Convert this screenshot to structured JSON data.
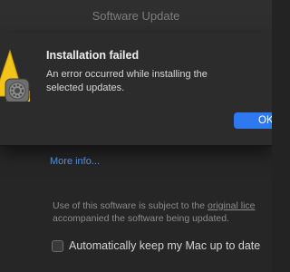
{
  "window": {
    "title": "Software Update"
  },
  "alert": {
    "title": "Installation failed",
    "message": "An error occurred while installing the selected updates.",
    "ok_label": "OK",
    "icon": "warning-gear-icon"
  },
  "content": {
    "more_info": "More info...",
    "license_line1_prefix": "Use of this software is subject to the ",
    "license_link": "original lice",
    "license_line2": "accompanied the software being updated.",
    "auto_update_label": "Automatically keep my Mac up to date",
    "auto_update_checked": false
  },
  "colors": {
    "accent": "#2f79f0",
    "link": "#5f9cf0",
    "warning": "#f2c318"
  }
}
